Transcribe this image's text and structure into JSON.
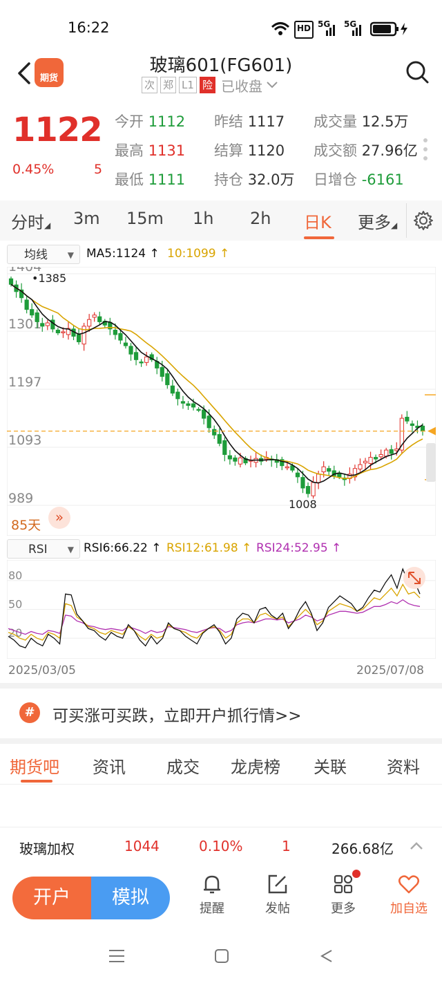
{
  "status_bar": {
    "time": "16:22",
    "hd": "HD",
    "net1": "5G",
    "net2": "5G"
  },
  "header": {
    "logo_text": "期货",
    "title": "玻璃601(FG601)",
    "tags": [
      "次",
      "郑",
      "L1",
      "险"
    ],
    "status": "已收盘"
  },
  "quote": {
    "price": "1122",
    "change_pct": "0.45%",
    "change": "5",
    "fields": [
      {
        "label": "今开",
        "value": "1112",
        "color": "green"
      },
      {
        "label": "昨结",
        "value": "1117",
        "color": "dark"
      },
      {
        "label": "成交量",
        "value": "12.5万",
        "color": "dark"
      },
      {
        "label": "最高",
        "value": "1131",
        "color": "red"
      },
      {
        "label": "结算",
        "value": "1120",
        "color": "dark"
      },
      {
        "label": "成交额",
        "value": "27.96亿",
        "color": "dark"
      },
      {
        "label": "最低",
        "value": "1111",
        "color": "green"
      },
      {
        "label": "持仓",
        "value": "32.0万",
        "color": "dark"
      },
      {
        "label": "日增仓",
        "value": "-6161",
        "color": "green"
      }
    ]
  },
  "period_tabs": [
    "分时",
    "3m",
    "15m",
    "1h",
    "2h",
    "日K",
    "更多"
  ],
  "active_period": "日K",
  "indicators": {
    "ma_select": "均线",
    "ma5": "MA5:1124",
    "ma10": "10:1099",
    "days": "85天",
    "rsi_select": "RSI",
    "rsi6": "RSI6:66.22",
    "rsi12": "RSI12:61.98",
    "rsi24": "RSI24:52.95",
    "date_start": "2025/03/05",
    "date_end": "2025/07/08"
  },
  "colors": {
    "up": "#e0302a",
    "down": "#1e9c3a",
    "accent": "#f0673a",
    "ma5": "#111111",
    "ma10": "#d9a400",
    "rsi24": "#b030b0"
  },
  "chart_data": [
    {
      "type": "candlestick",
      "title": "",
      "y_ticks": [
        1404,
        1301,
        1197,
        1093,
        989
      ],
      "ylim": [
        989,
        1404
      ],
      "annotations": {
        "high_label": "1385",
        "low_label": "1008",
        "last_price": 1122
      },
      "x_range": [
        "2025/03/05",
        "2025/07/08"
      ],
      "close_approx": [
        1385,
        1372,
        1361,
        1340,
        1330,
        1318,
        1310,
        1316,
        1305,
        1298,
        1300,
        1306,
        1292,
        1282,
        1310,
        1322,
        1330,
        1318,
        1312,
        1305,
        1295,
        1285,
        1275,
        1260,
        1250,
        1245,
        1255,
        1250,
        1235,
        1220,
        1205,
        1190,
        1180,
        1172,
        1168,
        1165,
        1160,
        1145,
        1128,
        1115,
        1100,
        1080,
        1072,
        1068,
        1074,
        1065,
        1070,
        1073,
        1068,
        1075,
        1070,
        1066,
        1060,
        1058,
        1052,
        1040,
        1020,
        1010,
        1030,
        1045,
        1058,
        1050,
        1042,
        1040,
        1035,
        1045,
        1055,
        1062,
        1068,
        1075,
        1072,
        1080,
        1088,
        1082,
        1090,
        1145,
        1140,
        1132,
        1128,
        1122
      ],
      "ma5_label": "MA5:1124",
      "ma10_label": "10:1099"
    },
    {
      "type": "line",
      "title": "RSI",
      "y_ticks": [
        80,
        50,
        20
      ],
      "ylim": [
        0,
        100
      ],
      "series": [
        {
          "name": "RSI6",
          "color": "#111111",
          "values": [
            22,
            18,
            12,
            10,
            20,
            15,
            12,
            24,
            20,
            14,
            66,
            65,
            45,
            38,
            30,
            28,
            22,
            18,
            26,
            22,
            20,
            34,
            28,
            18,
            12,
            22,
            14,
            20,
            36,
            30,
            28,
            22,
            18,
            14,
            25,
            30,
            34,
            26,
            14,
            20,
            40,
            46,
            44,
            36,
            50,
            52,
            44,
            40,
            46,
            30,
            38,
            50,
            58,
            46,
            28,
            36,
            52,
            58,
            64,
            60,
            56,
            48,
            52,
            62,
            70,
            68,
            78,
            86,
            72,
            92,
            78,
            80,
            66
          ]
        },
        {
          "name": "RSI12",
          "color": "#d9a400",
          "values": [
            26,
            24,
            20,
            18,
            24,
            20,
            18,
            26,
            24,
            20,
            56,
            54,
            42,
            38,
            32,
            30,
            26,
            24,
            28,
            26,
            24,
            32,
            28,
            22,
            18,
            24,
            20,
            22,
            34,
            30,
            28,
            26,
            22,
            20,
            26,
            30,
            32,
            28,
            20,
            24,
            36,
            40,
            40,
            36,
            44,
            46,
            42,
            40,
            42,
            32,
            38,
            44,
            50,
            44,
            34,
            38,
            48,
            52,
            56,
            54,
            52,
            48,
            50,
            56,
            62,
            60,
            66,
            72,
            64,
            76,
            66,
            68,
            62
          ]
        },
        {
          "name": "RSI24",
          "color": "#b030b0",
          "values": [
            30,
            28,
            26,
            24,
            27,
            25,
            24,
            28,
            27,
            25,
            44,
            43,
            38,
            36,
            33,
            32,
            30,
            29,
            30,
            29,
            28,
            32,
            30,
            28,
            25,
            28,
            26,
            27,
            32,
            31,
            30,
            29,
            27,
            26,
            28,
            30,
            31,
            30,
            26,
            28,
            34,
            36,
            37,
            36,
            38,
            40,
            40,
            39,
            40,
            36,
            38,
            40,
            44,
            42,
            38,
            40,
            44,
            46,
            48,
            48,
            47,
            46,
            47,
            50,
            53,
            53,
            55,
            58,
            56,
            60,
            56,
            54,
            53
          ]
        }
      ]
    }
  ],
  "promo": {
    "icon": "#",
    "text": "可买涨可买跌，立即开户抓行情>>"
  },
  "bottom_tabs": [
    "期货吧",
    "资讯",
    "成交",
    "龙虎榜",
    "关联",
    "资料"
  ],
  "active_bottom_tab": "期货吧",
  "ticker": {
    "name": "玻璃加权",
    "price": "1044",
    "pct": "0.10%",
    "change": "1",
    "amount": "266.68亿"
  },
  "actions": {
    "open": "开户",
    "simulate": "模拟",
    "remind": "提醒",
    "post": "发帖",
    "more": "更多",
    "favorite": "加自选"
  }
}
